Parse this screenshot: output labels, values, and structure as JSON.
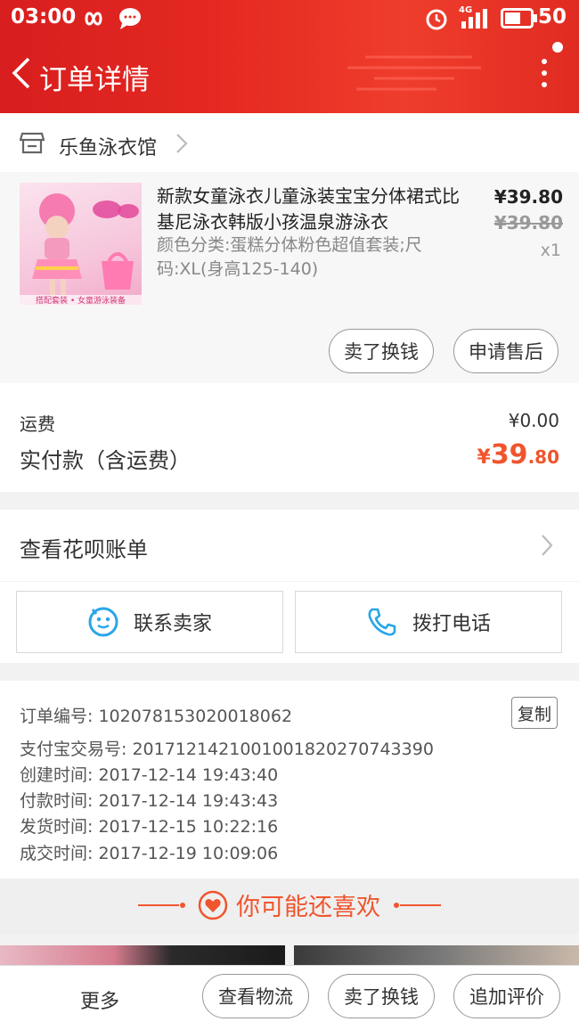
{
  "status": {
    "time": "03:00",
    "battery": "50",
    "network": "4G"
  },
  "header": {
    "title": "订单详情"
  },
  "shop": {
    "name": "乐鱼泳衣馆"
  },
  "item": {
    "title": "新款女童泳衣儿童泳装宝宝分体裙式比基尼泳衣韩版小孩温泉游泳衣",
    "spec": "颜色分类:蛋糕分体粉色超值套装;尺码:XL(身高125-140)",
    "price": "¥39.80",
    "original_price": "¥39.80",
    "quantity": "x1",
    "image_caption": "搭配套装 • 女童游泳装备",
    "actions": [
      "卖了换钱",
      "申请售后"
    ]
  },
  "fees": {
    "shipping_label": "运费",
    "shipping_value": "¥0.00",
    "paid_label": "实付款（含运费）",
    "paid_currency": "¥",
    "paid_int": "39",
    "paid_dec": ".80"
  },
  "huabei": {
    "label": "查看花呗账单"
  },
  "contact": {
    "seller_label": "联系卖家",
    "call_label": "拨打电话"
  },
  "order_info": {
    "order_no": "订单编号: 102078153020018062",
    "alipay_no": "支付宝交易号: 2017121421001001820270743390",
    "created": "创建时间: 2017-12-14 19:43:40",
    "paid": "付款时间: 2017-12-14 19:43:43",
    "shipped": "发货时间: 2017-12-15 10:22:16",
    "closed": "成交时间: 2017-12-19 10:09:06",
    "copy_label": "复制"
  },
  "recommend": {
    "title": "你可能还喜欢"
  },
  "bottom_bar": {
    "more": "更多",
    "logistics": "查看物流",
    "sell": "卖了换钱",
    "review": "追加评价"
  },
  "colors": {
    "header_red": "#e52a22",
    "accent_orange": "#f0552d"
  }
}
